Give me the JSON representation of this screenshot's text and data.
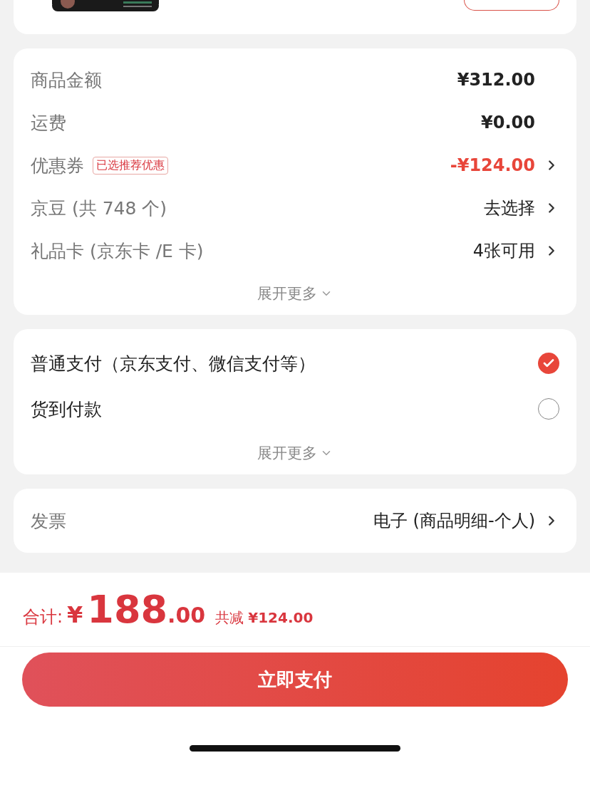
{
  "fee_rows": [
    {
      "label": "商品金额",
      "value": "¥312.00",
      "kind": "amount",
      "arrow": false
    },
    {
      "label": "运费",
      "value": "¥0.00",
      "kind": "amount",
      "arrow": false
    },
    {
      "label": "优惠券",
      "badge": "已选推荐优惠",
      "value": "-¥124.00",
      "kind": "discount",
      "arrow": true
    },
    {
      "label": "京豆 (共 748 个)",
      "value": "去选择",
      "kind": "action",
      "arrow": true
    },
    {
      "label": "礼品卡 (京东卡 /E 卡)",
      "value": "4张可用",
      "kind": "action",
      "arrow": true
    }
  ],
  "fee_expand": "展开更多",
  "payment_options": [
    {
      "label": "普通支付（京东支付、微信支付等）",
      "selected": true
    },
    {
      "label": "货到付款",
      "selected": false
    }
  ],
  "payment_expand": "展开更多",
  "invoice": {
    "label": "发票",
    "value": "电子 (商品明细-个人)"
  },
  "total": {
    "label": "合计:",
    "currency": "¥",
    "integer": "188",
    "decimal": ".00",
    "saved_label": "共减",
    "saved_value": "¥124.00"
  },
  "pay_button": "立即支付"
}
